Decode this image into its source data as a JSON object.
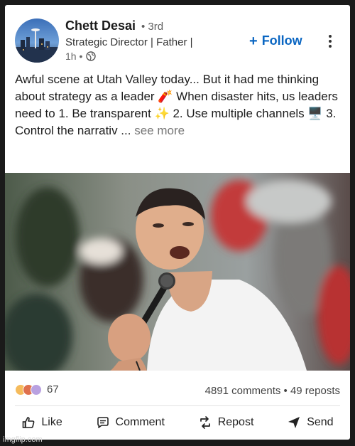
{
  "post": {
    "author_name": "Chett Desai",
    "degree": "• 3rd",
    "headline": "Strategic Director | Father |",
    "time": "1h •",
    "follow_label": "Follow",
    "body": "Awful scene at Utah Valley today... But it had me thinking about strategy as a leader 🧨 When disaster hits, us leaders need to 1. Be transparent ✨ 2. Use multiple channels 🖥️ 3. Control the narrativ ...",
    "see_more": "see more"
  },
  "engagement": {
    "reaction_count": "67",
    "stats": "4891 comments • 49 reposts"
  },
  "actions": [
    {
      "label": "Like",
      "icon": "thumbs-up-icon"
    },
    {
      "label": "Comment",
      "icon": "comment-icon"
    },
    {
      "label": "Repost",
      "icon": "repost-icon"
    },
    {
      "label": "Send",
      "icon": "send-icon"
    }
  ],
  "watermark": "imgflip.com",
  "colors": {
    "accent": "#0a66c2",
    "text": "#1c1c1c",
    "muted": "#666666"
  }
}
